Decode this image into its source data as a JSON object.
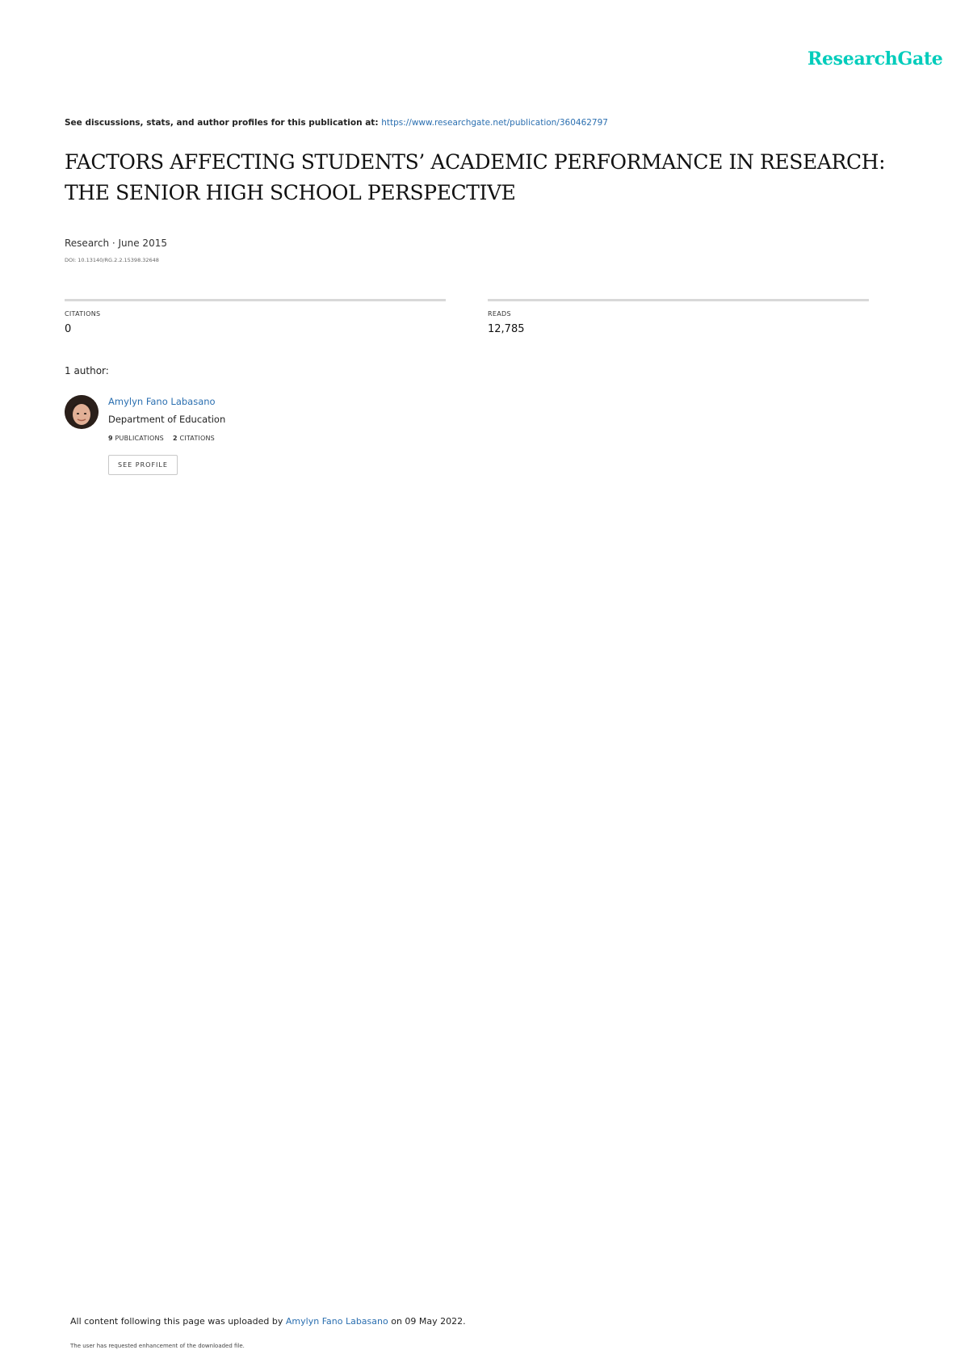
{
  "brand": {
    "logo_text": "ResearchGate",
    "logo_color": "#00ccbb",
    "link_color": "#2b6fb0"
  },
  "header": {
    "discussion_prefix": "See discussions, stats, and author profiles for this publication at: ",
    "publication_url": "https://www.researchgate.net/publication/360462797"
  },
  "publication": {
    "title_line_1": "FACTORS AFFECTING STUDENTS’ ACADEMIC PERFORMANCE IN RESEARCH:",
    "title_line_2": "THE SENIOR HIGH SCHOOL PERSPECTIVE",
    "type_and_date": "Research · June 2015",
    "doi": "DOI: 10.13140/RG.2.2.15398.32648"
  },
  "stats": {
    "citations_label": "CITATIONS",
    "citations_value": "0",
    "reads_label": "READS",
    "reads_value": "12,785"
  },
  "authors": {
    "count_label": "1 author:",
    "items": [
      {
        "name": "Amylyn Fano Labasano",
        "affiliation": "Department of Education",
        "publications_count": "9",
        "publications_label": "PUBLICATIONS",
        "citations_count": "2",
        "citations_label": "CITATIONS",
        "button_label": "SEE PROFILE"
      }
    ]
  },
  "footer": {
    "uploaded_prefix": "All content following this page was uploaded by ",
    "uploader_name": "Amylyn Fano Labasano",
    "uploaded_suffix": " on 09 May 2022.",
    "enhancement_note": "The user has requested enhancement of the downloaded file."
  }
}
